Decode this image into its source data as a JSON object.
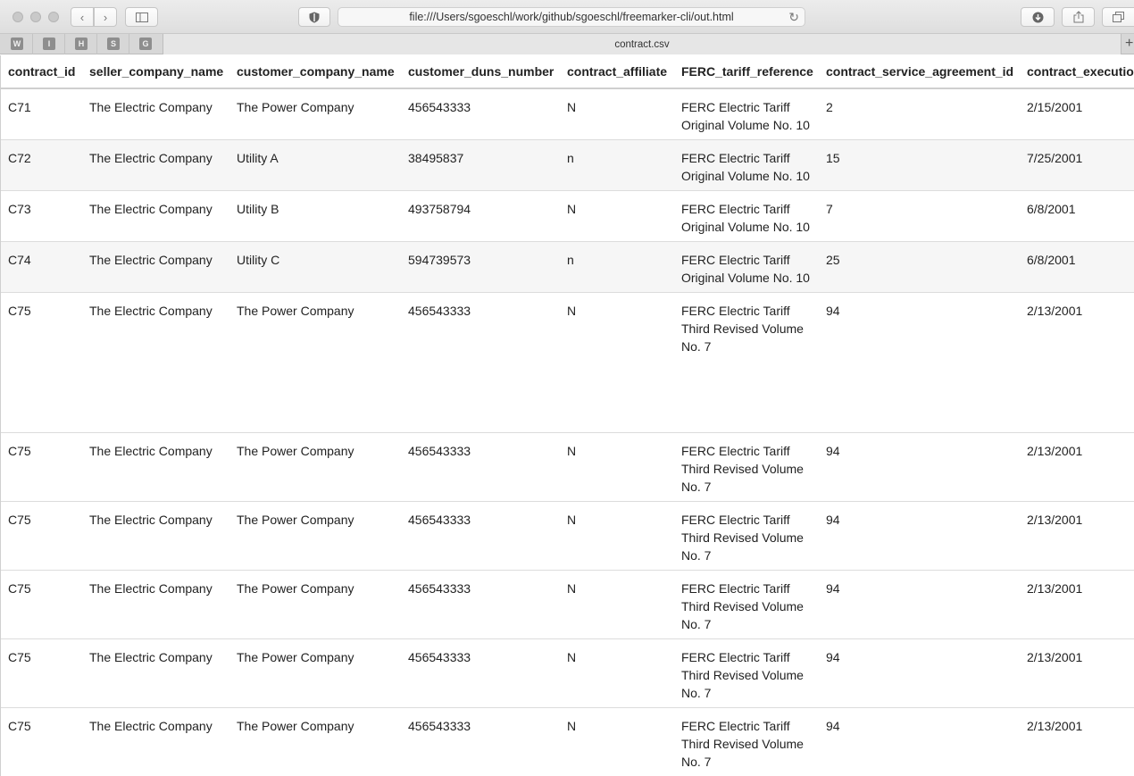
{
  "browser": {
    "url": "file:///Users/sgoeschl/work/github/sgoeschl/freemarker-cli/out.html",
    "tab_title": "contract.csv",
    "favorites": [
      "W",
      "I",
      "H",
      "S",
      "G"
    ],
    "new_tab_label": "+"
  },
  "table": {
    "columns": [
      "contract_id",
      "seller_company_name",
      "customer_company_name",
      "customer_duns_number",
      "contract_affiliate",
      "FERC_tariff_reference",
      "contract_service_agreement_id",
      "contract_executio"
    ],
    "rows": [
      {
        "id": "C71",
        "seller": "The Electric Company",
        "customer": "The Power Company",
        "duns": "456543333",
        "affiliate": "N",
        "ferc": "FERC Electric Tariff Original Volume No. 10",
        "agreement": "2",
        "execution": "2/15/2001"
      },
      {
        "id": "C72",
        "seller": "The Electric Company",
        "customer": "Utility A",
        "duns": "38495837",
        "affiliate": "n",
        "ferc": "FERC Electric Tariff Original Volume No. 10",
        "agreement": "15",
        "execution": "7/25/2001"
      },
      {
        "id": "C73",
        "seller": "The Electric Company",
        "customer": "Utility B",
        "duns": "493758794",
        "affiliate": "N",
        "ferc": "FERC Electric Tariff Original Volume No. 10",
        "agreement": "7",
        "execution": "6/8/2001"
      },
      {
        "id": "C74",
        "seller": "The Electric Company",
        "customer": "Utility C",
        "duns": "594739573",
        "affiliate": "n",
        "ferc": "FERC Electric Tariff Original Volume No. 10",
        "agreement": "25",
        "execution": "6/8/2001"
      },
      {
        "id": "C75",
        "seller": "The Electric Company",
        "customer": "The Power Company",
        "duns": "456543333",
        "affiliate": "N",
        "ferc": "FERC Electric Tariff Third Revised Volume No. 7",
        "agreement": "94",
        "execution": "2/13/2001"
      },
      {
        "id": "C75",
        "seller": "The Electric Company",
        "customer": "The Power Company",
        "duns": "456543333",
        "affiliate": "N",
        "ferc": "FERC Electric Tariff Third Revised Volume No. 7",
        "agreement": "94",
        "execution": "2/13/2001"
      },
      {
        "id": "C75",
        "seller": "The Electric Company",
        "customer": "The Power Company",
        "duns": "456543333",
        "affiliate": "N",
        "ferc": "FERC Electric Tariff Third Revised Volume No. 7",
        "agreement": "94",
        "execution": "2/13/2001"
      },
      {
        "id": "C75",
        "seller": "The Electric Company",
        "customer": "The Power Company",
        "duns": "456543333",
        "affiliate": "N",
        "ferc": "FERC Electric Tariff Third Revised Volume No. 7",
        "agreement": "94",
        "execution": "2/13/2001"
      },
      {
        "id": "C75",
        "seller": "The Electric Company",
        "customer": "The Power Company",
        "duns": "456543333",
        "affiliate": "N",
        "ferc": "FERC Electric Tariff Third Revised Volume No. 7",
        "agreement": "94",
        "execution": "2/13/2001"
      },
      {
        "id": "C75",
        "seller": "The Electric Company",
        "customer": "The Power Company",
        "duns": "456543333",
        "affiliate": "N",
        "ferc": "FERC Electric Tariff Third Revised Volume No. 7",
        "agreement": "94",
        "execution": "2/13/2001"
      }
    ]
  }
}
